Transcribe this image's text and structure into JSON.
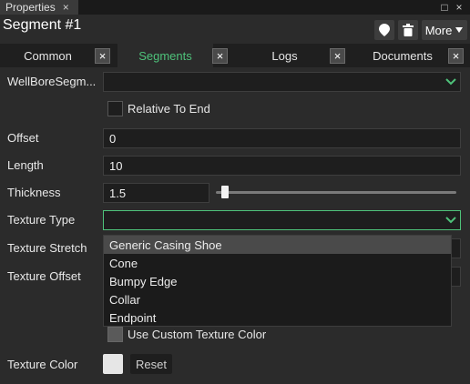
{
  "panel_tab": {
    "label": "Properties",
    "close": "×"
  },
  "window_controls": {
    "maximize": "□",
    "close": "×"
  },
  "header": {
    "title": "Segment #1",
    "more_label": "More"
  },
  "tabs": [
    {
      "label": "Common",
      "active": false
    },
    {
      "label": "Segments",
      "active": true
    },
    {
      "label": "Logs",
      "active": false
    },
    {
      "label": "Documents",
      "active": false
    }
  ],
  "tab_close": "×",
  "form": {
    "wellbore_label": "WellBoreSegm...",
    "wellbore_value": "",
    "relative_label": "Relative To End",
    "offset_label": "Offset",
    "offset_value": "0",
    "length_label": "Length",
    "length_value": "10",
    "thickness_label": "Thickness",
    "thickness_value": "1.5",
    "thickness_slider_fraction": 0.03,
    "texture_type_label": "Texture Type",
    "texture_type_value": "",
    "texture_stretch_label": "Texture Stretch",
    "texture_offset_label": "Texture Offset",
    "use_custom_color_label": "Use Custom Texture Color",
    "texture_color_label": "Texture Color",
    "reset_label": "Reset"
  },
  "dropdown_options": [
    "Generic Casing Shoe",
    "Cone",
    "Bumpy Edge",
    "Collar",
    "Endpoint"
  ],
  "colors": {
    "accent": "#4ec27a",
    "background": "#2b2b2b",
    "field": "#1e1e1e",
    "swatch": "#e6e6e6"
  }
}
